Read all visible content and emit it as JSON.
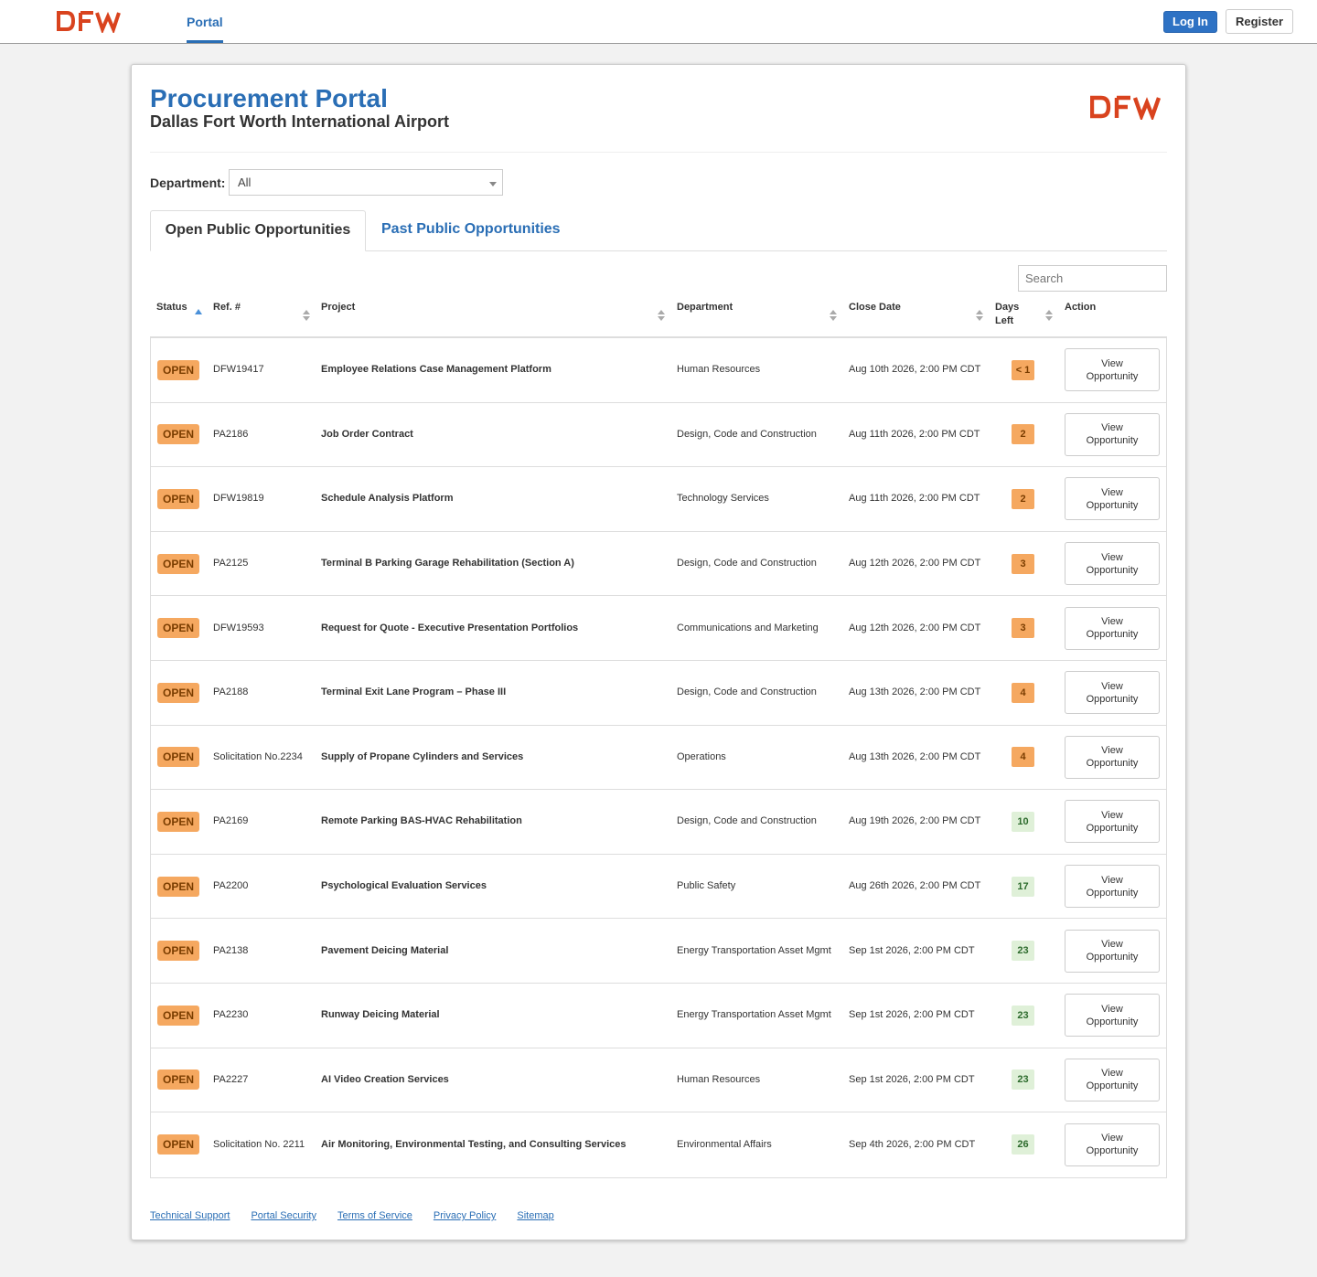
{
  "header": {
    "logo_text": "DFW",
    "nav_portal": "Portal",
    "login_label": "Log In",
    "register_label": "Register"
  },
  "colors": {
    "brand_red": "#d9431e",
    "accent_blue": "#2a6eb5",
    "open_orange": "#f5a860",
    "days_green": "#dff0d8"
  },
  "page": {
    "title": "Procurement Portal",
    "subtitle": "Dallas Fort Worth International Airport"
  },
  "filter": {
    "label": "Department:",
    "selected": "All"
  },
  "tabs": {
    "open": "Open Public Opportunities",
    "past": "Past Public Opportunities"
  },
  "search": {
    "placeholder": "Search"
  },
  "table": {
    "headers": {
      "status": "Status",
      "ref": "Ref. #",
      "project": "Project",
      "department": "Department",
      "close_date": "Close Date",
      "days_left": "Days Left",
      "action": "Action"
    },
    "action_label": "View Opportunity",
    "rows": [
      {
        "status": "OPEN",
        "ref": "DFW19417",
        "project": "Employee Relations Case Management Platform",
        "department": "Human Resources",
        "close": "Aug 10th 2026, 2:00 PM CDT",
        "days": "< 1",
        "days_color": "orange"
      },
      {
        "status": "OPEN",
        "ref": "PA2186",
        "project": "Job Order Contract",
        "department": "Design, Code and Construction",
        "close": "Aug 11th 2026, 2:00 PM CDT",
        "days": "2",
        "days_color": "orange"
      },
      {
        "status": "OPEN",
        "ref": "DFW19819",
        "project": "Schedule Analysis Platform",
        "department": "Technology Services",
        "close": "Aug 11th 2026, 2:00 PM CDT",
        "days": "2",
        "days_color": "orange"
      },
      {
        "status": "OPEN",
        "ref": "PA2125",
        "project": "Terminal B Parking Garage Rehabilitation (Section A)",
        "department": "Design, Code and Construction",
        "close": "Aug 12th 2026, 2:00 PM CDT",
        "days": "3",
        "days_color": "orange"
      },
      {
        "status": "OPEN",
        "ref": "DFW19593",
        "project": "Request for Quote - Executive Presentation Portfolios",
        "department": "Communications and Marketing",
        "close": "Aug 12th 2026, 2:00 PM CDT",
        "days": "3",
        "days_color": "orange"
      },
      {
        "status": "OPEN",
        "ref": "PA2188",
        "project": "Terminal Exit Lane Program – Phase III",
        "department": "Design, Code and Construction",
        "close": "Aug 13th 2026, 2:00 PM CDT",
        "days": "4",
        "days_color": "orange"
      },
      {
        "status": "OPEN",
        "ref": "Solicitation No.2234",
        "project": "Supply of Propane Cylinders and Services",
        "department": "Operations",
        "close": "Aug 13th 2026, 2:00 PM CDT",
        "days": "4",
        "days_color": "orange"
      },
      {
        "status": "OPEN",
        "ref": "PA2169",
        "project": "Remote Parking BAS-HVAC Rehabilitation",
        "department": "Design, Code and Construction",
        "close": "Aug 19th 2026, 2:00 PM CDT",
        "days": "10",
        "days_color": "green"
      },
      {
        "status": "OPEN",
        "ref": "PA2200",
        "project": "Psychological Evaluation Services",
        "department": "Public Safety",
        "close": "Aug 26th 2026, 2:00 PM CDT",
        "days": "17",
        "days_color": "green"
      },
      {
        "status": "OPEN",
        "ref": "PA2138",
        "project": "Pavement Deicing Material",
        "department": "Energy Transportation Asset Mgmt",
        "close": "Sep 1st 2026, 2:00 PM CDT",
        "days": "23",
        "days_color": "green"
      },
      {
        "status": "OPEN",
        "ref": "PA2230",
        "project": "Runway Deicing Material",
        "department": "Energy Transportation Asset Mgmt",
        "close": "Sep 1st 2026, 2:00 PM CDT",
        "days": "23",
        "days_color": "green"
      },
      {
        "status": "OPEN",
        "ref": "PA2227",
        "project": "AI Video Creation Services",
        "department": "Human Resources",
        "close": "Sep 1st 2026, 2:00 PM CDT",
        "days": "23",
        "days_color": "green"
      },
      {
        "status": "OPEN",
        "ref": "Solicitation No. 2211",
        "project": "Air Monitoring, Environmental Testing, and Consulting Services",
        "department": "Environmental Affairs",
        "close": "Sep 4th 2026, 2:00 PM CDT",
        "days": "26",
        "days_color": "green"
      }
    ]
  },
  "footer": {
    "links": [
      "Technical Support",
      "Portal Security",
      "Terms of Service",
      "Privacy Policy",
      "Sitemap"
    ]
  }
}
